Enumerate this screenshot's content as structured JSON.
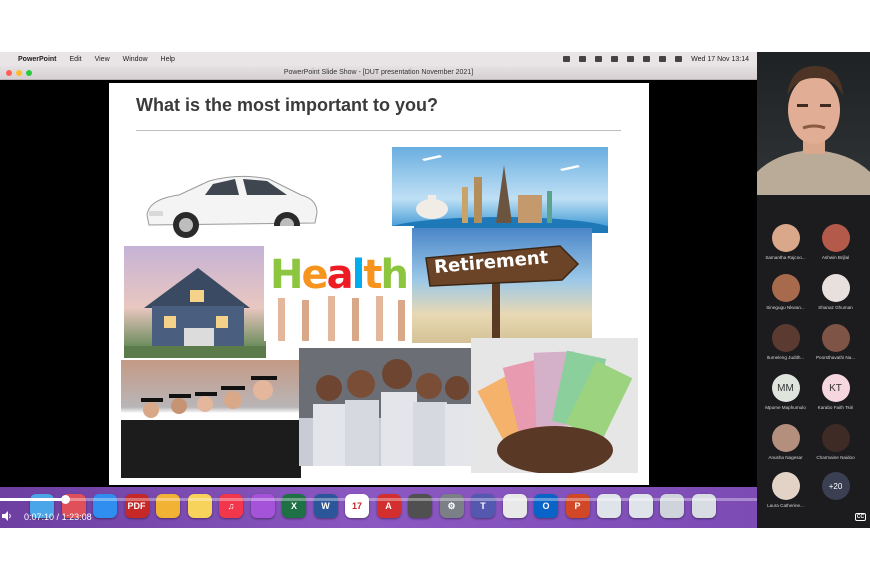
{
  "menubar": {
    "app": "PowerPoint",
    "items": [
      "Edit",
      "View",
      "Window",
      "Help"
    ],
    "clock": "Wed 17 Nov  13:14"
  },
  "window": {
    "title": "PowerPoint Slide Show - [DUT presentation November 2021]"
  },
  "slide": {
    "title": "What is the most important to you?",
    "health_word": [
      "H",
      "e",
      "a",
      "l",
      "t",
      "h"
    ],
    "health_colors": [
      "#8cc63f",
      "#f7941d",
      "#ed1c24",
      "#00aeef",
      "#f7941d",
      "#8cc63f"
    ],
    "retirement_sign": "Retirement"
  },
  "participants": [
    {
      "name": "Samantha Rajcoo...",
      "initials": "",
      "color": "#d9a88b"
    },
    {
      "name": "Ashwin Brijlal",
      "initials": "",
      "color": "#b35a4a"
    },
    {
      "name": "Sinegugu Nkwan...",
      "initials": "",
      "color": "#a86a4c"
    },
    {
      "name": "Shanaz Ghuman",
      "initials": "",
      "color": "#e8e0dd"
    },
    {
      "name": "Itumeleng Judith...",
      "initials": "",
      "color": "#5b3a32"
    },
    {
      "name": "Poorsthavathi Na...",
      "initials": "",
      "color": "#7d5445"
    },
    {
      "name": "Mpume Maphumulo",
      "initials": "MM",
      "color": "#dfe5dc"
    },
    {
      "name": "Karabo Faith Tsiri",
      "initials": "KT",
      "color": "#f6d6df"
    },
    {
      "name": "Anusha Nagesar",
      "initials": "",
      "color": "#b58f7d"
    },
    {
      "name": "Charmaine Naidoo",
      "initials": "",
      "color": "#3e2b26"
    },
    {
      "name": "Laura Catherine...",
      "initials": "",
      "color": "#e2d3c6"
    }
  ],
  "more_participants": "+20",
  "dock": {
    "icons": [
      {
        "name": "finder-icon",
        "label": "",
        "color": "#4aa6e8"
      },
      {
        "name": "launchpad-icon",
        "label": "",
        "color": "#e0505a"
      },
      {
        "name": "safari-icon",
        "label": "",
        "color": "#2f8ef0"
      },
      {
        "name": "pdf-app-icon",
        "label": "PDF",
        "color": "#c62828"
      },
      {
        "name": "photos-icon",
        "label": "",
        "color": "#f2b233"
      },
      {
        "name": "notes-icon",
        "label": "",
        "color": "#f7d35c"
      },
      {
        "name": "music-icon",
        "label": "♫",
        "color": "#f2364b"
      },
      {
        "name": "podcasts-icon",
        "label": "",
        "color": "#a553d9"
      },
      {
        "name": "excel-icon",
        "label": "X",
        "color": "#1e7145"
      },
      {
        "name": "word-icon",
        "label": "W",
        "color": "#2b579a"
      },
      {
        "name": "calendar-icon",
        "label": "17",
        "color": "#ffffff"
      },
      {
        "name": "acrobat-icon",
        "label": "A",
        "color": "#d32f2f"
      },
      {
        "name": "calculator-icon",
        "label": "",
        "color": "#505050"
      },
      {
        "name": "system-preferences-icon",
        "label": "⚙",
        "color": "#7b7f86"
      },
      {
        "name": "teams-icon",
        "label": "T",
        "color": "#5558af"
      },
      {
        "name": "chrome-icon",
        "label": "",
        "color": "#e9e9e9"
      },
      {
        "name": "outlook-icon",
        "label": "O",
        "color": "#0a64c8"
      },
      {
        "name": "powerpoint-icon",
        "label": "P",
        "color": "#d24726"
      },
      {
        "name": "screenshot-icon",
        "label": "",
        "color": "#dfe3ea"
      },
      {
        "name": "preview-icon",
        "label": "",
        "color": "#dfe3ea"
      },
      {
        "name": "downloads-icon",
        "label": "",
        "color": "#cfd4dc"
      },
      {
        "name": "trash-icon",
        "label": "",
        "color": "#d8dde4"
      }
    ]
  },
  "player": {
    "current_time": "0:07:10",
    "separator": "/",
    "total_time": "1:23:08",
    "progress": 0.086,
    "cc_label": "CC"
  }
}
